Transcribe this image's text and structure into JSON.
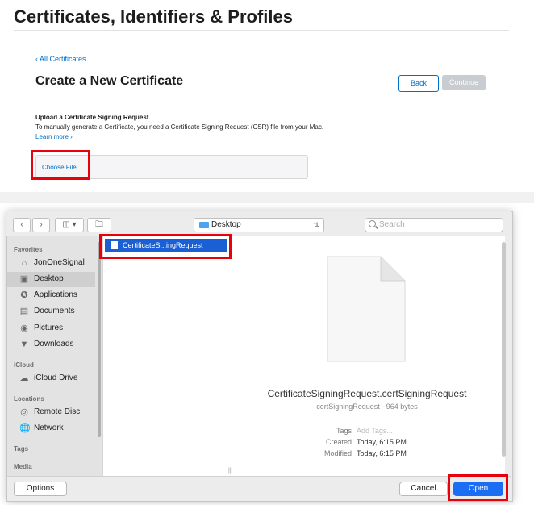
{
  "page": {
    "title": "Certificates, Identifiers & Profiles",
    "back_link": "‹ All Certificates",
    "section_title": "Create a New Certificate",
    "back_button": "Back",
    "continue_button": "Continue",
    "upload_title": "Upload a Certificate Signing Request",
    "upload_desc": "To manually generate a Certificate, you need a Certificate Signing Request (CSR) file from your Mac.",
    "learn_more": "Learn more ›",
    "choose_file": "Choose File"
  },
  "dialog": {
    "path": "Desktop",
    "search_placeholder": "Search",
    "sidebar": {
      "favorites_header": "Favorites",
      "favorites": [
        "JonOneSignal",
        "Desktop",
        "Applications",
        "Documents",
        "Pictures",
        "Downloads"
      ],
      "icloud_header": "iCloud",
      "icloud": [
        "iCloud Drive"
      ],
      "locations_header": "Locations",
      "locations": [
        "Remote Disc",
        "Network"
      ],
      "tags_header": "Tags",
      "media_header": "Media"
    },
    "selected_sidebar_item": "Desktop",
    "file_list": [
      "CertificateS...ingRequest"
    ],
    "preview": {
      "name": "CertificateSigningRequest.certSigningRequest",
      "subtitle": "certSigningRequest - 964 bytes",
      "tags_label": "Tags",
      "tags_placeholder": "Add Tags...",
      "created_label": "Created",
      "created_value": "Today, 6:15 PM",
      "modified_label": "Modified",
      "modified_value": "Today, 6:15 PM"
    },
    "options_button": "Options",
    "cancel_button": "Cancel",
    "open_button": "Open"
  },
  "colors": {
    "accent": "#0070c9",
    "highlight": "#e8000b",
    "selection": "#1a5fd4",
    "open_button": "#1b6ef3"
  }
}
